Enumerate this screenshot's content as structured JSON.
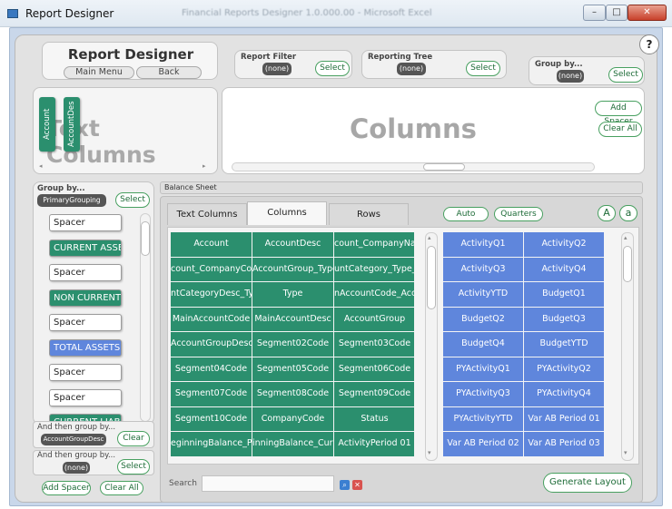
{
  "window": {
    "title": "Report Designer",
    "blurred_title": "Financial Reports Designer 1.0.000.00 - Microsoft Excel",
    "min": "–",
    "max": "□",
    "close": "✕"
  },
  "help": "?",
  "header": {
    "title": "Report Designer",
    "main_menu": "Main Menu",
    "back": "Back"
  },
  "report_filter": {
    "label": "Report Filter",
    "value": "(none)",
    "select": "Select"
  },
  "reporting_tree": {
    "label": "Reporting Tree",
    "value": "(none)",
    "select": "Select"
  },
  "group_by_top": {
    "label": "Group by...",
    "value": "(none)",
    "select": "Select"
  },
  "text_columns_area": {
    "watermark": "Text Columns",
    "chips": [
      "Account",
      "AccountDes"
    ]
  },
  "columns_area": {
    "watermark": "Columns",
    "add_spacer": "Add Spacer",
    "clear_all": "Clear All"
  },
  "left_panel": {
    "group_by": {
      "label": "Group by...",
      "value": "PrimaryGrouping",
      "select": "Select"
    },
    "items": [
      {
        "text": "Spacer",
        "kind": "white"
      },
      {
        "text": "CURRENT ASSETS",
        "kind": "green"
      },
      {
        "text": "Spacer",
        "kind": "white"
      },
      {
        "text": "NON CURRENT",
        "kind": "green"
      },
      {
        "text": "Spacer",
        "kind": "white"
      },
      {
        "text": "TOTAL ASSETS",
        "kind": "blue"
      },
      {
        "text": "Spacer",
        "kind": "white"
      },
      {
        "text": "Spacer",
        "kind": "white"
      },
      {
        "text": "CURRENT LIABI",
        "kind": "green"
      }
    ],
    "then_group_1": {
      "label": "And then group by...",
      "value": "AccountGroupDesc",
      "clear": "Clear"
    },
    "then_group_2": {
      "label": "And then group by...",
      "value": "(none)",
      "select": "Select"
    },
    "add_spacer": "Add Spacer",
    "clear_all": "Clear All"
  },
  "balance_sheet": {
    "label": "Balance Sheet",
    "tabs": [
      "Text Columns",
      "Columns",
      "Rows"
    ],
    "active_tab": 1,
    "auto": "Auto",
    "quarters": "Quarters",
    "font_up": "A",
    "font_down": "a",
    "green_grid": [
      [
        "Account",
        "AccountDesc",
        "count_CompanyNa"
      ],
      [
        "count_CompanyCo",
        "AccountGroup_Type",
        "untCategory_Type_"
      ],
      [
        "ntCategoryDesc_Typ",
        "Type",
        "nAccountCode_Acc"
      ],
      [
        "MainAccountCode",
        "MainAccountDesc",
        "AccountGroup"
      ],
      [
        "AccountGroupDesc",
        "Segment02Code",
        "Segment03Code"
      ],
      [
        "Segment04Code",
        "Segment05Code",
        "Segment06Code"
      ],
      [
        "Segment07Code",
        "Segment08Code",
        "Segment09Code"
      ],
      [
        "Segment10Code",
        "CompanyCode",
        "Status"
      ],
      [
        "eginningBalance_Pri",
        "inningBalance_Curr",
        "ActivityPeriod 01"
      ]
    ],
    "blue_grid": [
      [
        "ActivityQ1",
        "ActivityQ2"
      ],
      [
        "ActivityQ3",
        "ActivityQ4"
      ],
      [
        "ActivityYTD",
        "BudgetQ1"
      ],
      [
        "BudgetQ2",
        "BudgetQ3"
      ],
      [
        "BudgetQ4",
        "BudgetYTD"
      ],
      [
        "PYActivityQ1",
        "PYActivityQ2"
      ],
      [
        "PYActivityQ3",
        "PYActivityQ4"
      ],
      [
        "PYActivityYTD",
        "Var AB Period 01"
      ],
      [
        "Var AB Period 02",
        "Var AB Period 03"
      ]
    ],
    "search_label": "Search",
    "search_value": "",
    "generate": "Generate Layout"
  },
  "colors": {
    "green": "#2b8f6e",
    "blue": "#5f86dc",
    "pill_border": "#48a060"
  }
}
